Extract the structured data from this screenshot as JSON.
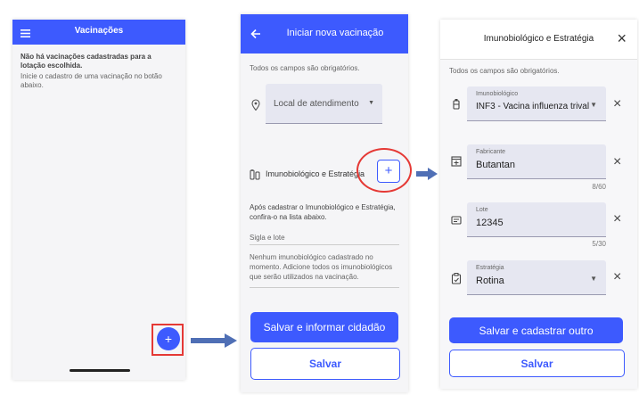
{
  "screen1": {
    "title": "Vacinações",
    "empty_title": "Não há vacinações cadastradas para a lotação escolhida.",
    "empty_hint": "Inicie o cadastro de uma vacinação no botão abaixo.",
    "fab_label": "+"
  },
  "screen2": {
    "title": "Iniciar nova vacinação",
    "required_note": "Todos os campos são obrigatórios.",
    "location_placeholder": "Local de atendimento",
    "section_label": "Imunobiológico e Estratégia",
    "add_label": "+",
    "after_note": "Após cadastrar o Imunobiológico e Estratégia, confira-o na lista abaixo.",
    "list_header": "Sigla e lote",
    "empty_list": "Nenhum imunobiológico cadastrado no momento. Adicione todos os imunobiológicos que serão utilizados na vacinação.",
    "primary_button": "Salvar e informar cidadão",
    "secondary_button": "Salvar"
  },
  "screen3": {
    "title": "Imunobiológico e Estratégia",
    "close": "×",
    "required_note": "Todos os campos são obrigatórios.",
    "fields": [
      {
        "label": "Imunobiológico",
        "value": "INF3 - Vacina influenza trival",
        "counter": ""
      },
      {
        "label": "Fabricante",
        "value": "Butantan",
        "counter": "8/60"
      },
      {
        "label": "Lote",
        "value": "12345",
        "counter": "5/30"
      },
      {
        "label": "Estratégia",
        "value": "Rotina",
        "counter": ""
      }
    ],
    "clear": "×",
    "caret": "▼",
    "primary_button": "Salvar e cadastrar outro",
    "secondary_button": "Salvar"
  },
  "colors": {
    "primary": "#3d5afe",
    "highlight": "#e53935",
    "arrow": "#4f6fb5"
  }
}
